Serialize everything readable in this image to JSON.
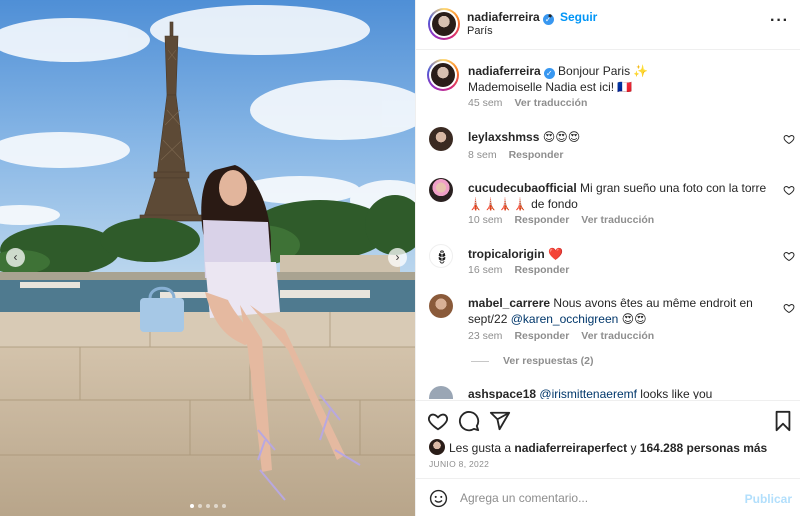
{
  "post": {
    "username": "nadiaferreira",
    "follow_label": "Seguir",
    "location": "París",
    "separator": "•",
    "more_label": "···"
  },
  "caption": {
    "username": "nadiaferreira",
    "text_line1": "Bonjour Paris ✨",
    "text_line2": "Mademoiselle Nadia est ici! 🇫🇷",
    "time": "45 sem",
    "translate": "Ver traducción"
  },
  "comments": [
    {
      "username": "leylaxshmss",
      "text": "😍😍😍",
      "time": "8 sem",
      "reply": "Responder"
    },
    {
      "username": "cucudecubaofficial",
      "text": "Mi gran sueño una foto con la torre 🗼🗼🗼🗼 de fondo",
      "time": "10 sem",
      "reply": "Responder",
      "translate": "Ver traducción"
    },
    {
      "username": "tropicalorigin",
      "text": "❤️",
      "time": "16 sem",
      "reply": "Responder"
    },
    {
      "username": "mabel_carrere",
      "text_line1": "Nous avons êtes au même endroit en",
      "text_line2_plain": "sept/22",
      "mention": "@karen_occhigreen",
      "text_line2_end": "😍😍",
      "time": "23 sem",
      "reply": "Responder",
      "translate": "Ver traducción"
    },
    {
      "username": "ashspace18",
      "mention": "@irismittenaeremf",
      "text": "looks like you"
    }
  ],
  "view_replies": "Ver respuestas (2)",
  "likes": {
    "prefix": "Les gusta a",
    "liker": "nadiaferreiraperfect",
    "middle": "y",
    "count": "164.288 personas más"
  },
  "date": "JUNIO 8, 2022",
  "add_comment": {
    "placeholder": "Agrega un comentario...",
    "publish": "Publicar"
  },
  "icons": {
    "verified": "verified-badge-icon",
    "like": "heart-icon",
    "comment": "comment-icon",
    "share": "paper-plane-icon",
    "save": "bookmark-icon",
    "emoji": "smiley-icon",
    "more": "more-horizontal-icon"
  },
  "colors": {
    "link_blue": "#0095f6",
    "verified_blue": "#3897f0",
    "mention_blue": "#00376b",
    "muted": "#8e8e8e",
    "publish_disabled": "#b2dffc"
  },
  "carousel": {
    "slide_count": 5,
    "active_slide": 1
  }
}
